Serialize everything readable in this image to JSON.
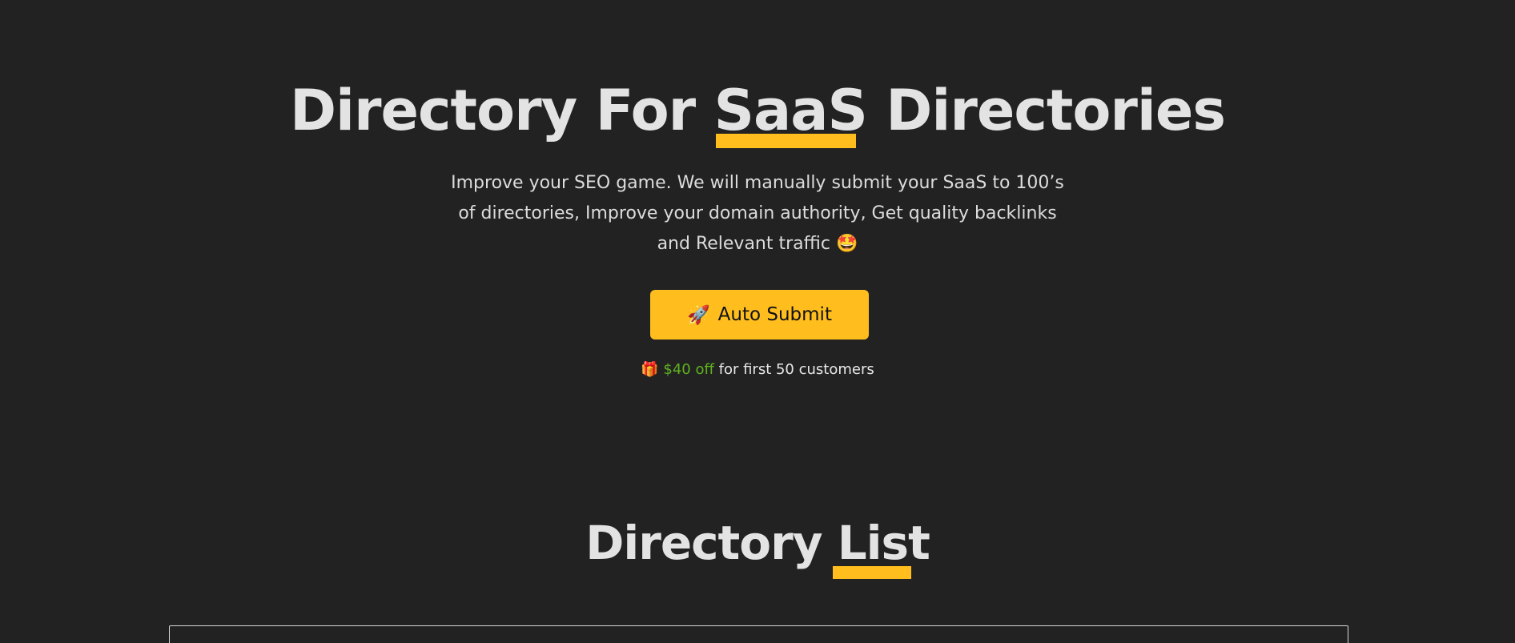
{
  "hero": {
    "title_before": "Directory For ",
    "title_highlight": "SaaS",
    "title_after": " Directories",
    "subtitle": "Improve your SEO game. We will manually submit your SaaS to 100’s of directories, Improve your domain authority, Get quality backlinks and Relevant traffic",
    "subtitle_emoji": "🤩"
  },
  "cta": {
    "icon": "🚀",
    "label": "Auto Submit"
  },
  "offer": {
    "icon": "🎁",
    "price": "$40 off",
    "text": " for first 50 customers"
  },
  "directory_section": {
    "title_before": "Directory ",
    "title_highlight": "List"
  },
  "colors": {
    "background": "#222222",
    "accent": "#ffbe1e",
    "offer_green": "#5fb31e",
    "text": "#e3e3e3"
  }
}
